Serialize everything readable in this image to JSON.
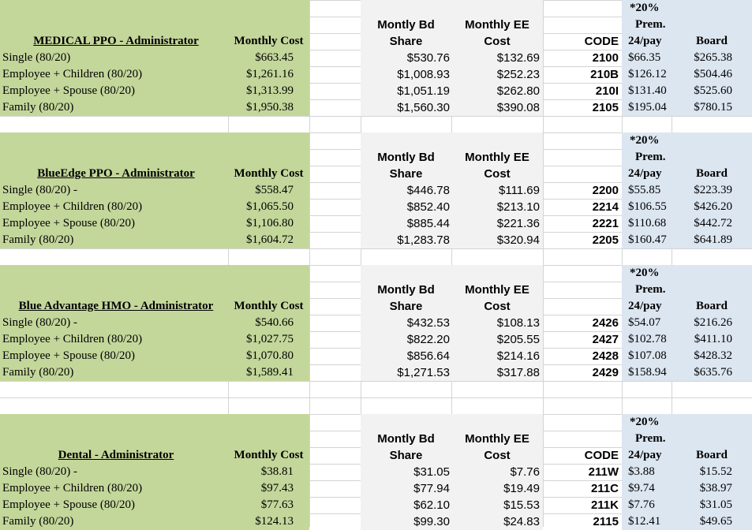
{
  "sections": [
    {
      "title": "MEDICAL PPO - Administrator",
      "cost_header": "Monthly Cost",
      "bd_header": [
        "Montly Bd",
        "Share"
      ],
      "ee_header": [
        "Monthly EE",
        "Cost"
      ],
      "code_header": "CODE",
      "prem_header": [
        "*20%",
        "Prem.",
        "24/pay"
      ],
      "board_header": "Board",
      "rows": [
        {
          "label": "Single (80/20)",
          "cost": "$663.45",
          "bd": "$530.76",
          "ee": "$132.69",
          "code": "2100",
          "prem": "$66.35",
          "board": "$265.38"
        },
        {
          "label": "Employee + Children (80/20)",
          "cost": "$1,261.16",
          "bd": "$1,008.93",
          "ee": "$252.23",
          "code": "210B",
          "prem": "$126.12",
          "board": "$504.46"
        },
        {
          "label": "Employee + Spouse (80/20)",
          "cost": "$1,313.99",
          "bd": "$1,051.19",
          "ee": "$262.80",
          "code": "210I",
          "prem": "$131.40",
          "board": "$525.60"
        },
        {
          "label": "Family (80/20)",
          "cost": "$1,950.38",
          "bd": "$1,560.30",
          "ee": "$390.08",
          "code": "2105",
          "prem": "$195.04",
          "board": "$780.15"
        }
      ]
    },
    {
      "title": "BlueEdge PPO - Administrator",
      "cost_header": "Monthly Cost",
      "bd_header": [
        "Montly Bd",
        "Share"
      ],
      "ee_header": [
        "Monthly EE",
        "Cost"
      ],
      "code_header": "",
      "prem_header": [
        "*20%",
        "Prem.",
        "24/pay"
      ],
      "board_header": "Board",
      "rows": [
        {
          "label": "Single (80/20) -",
          "cost": "$558.47",
          "bd": "$446.78",
          "ee": "$111.69",
          "code": "2200",
          "prem": "$55.85",
          "board": "$223.39"
        },
        {
          "label": "Employee + Children (80/20)",
          "cost": "$1,065.50",
          "bd": "$852.40",
          "ee": "$213.10",
          "code": "2214",
          "prem": "$106.55",
          "board": "$426.20"
        },
        {
          "label": "Employee + Spouse (80/20)",
          "cost": "$1,106.80",
          "bd": "$885.44",
          "ee": "$221.36",
          "code": "2221",
          "prem": "$110.68",
          "board": "$442.72"
        },
        {
          "label": "Family (80/20)",
          "cost": "$1,604.72",
          "bd": "$1,283.78",
          "ee": "$320.94",
          "code": "2205",
          "prem": "$160.47",
          "board": "$641.89"
        }
      ]
    },
    {
      "title": "Blue Advantage HMO - Administrator",
      "cost_header": "Monthly Cost",
      "bd_header": [
        "Montly Bd",
        "Share"
      ],
      "ee_header": [
        "Monthly EE",
        "Cost"
      ],
      "code_header": "",
      "prem_header": [
        "*20%",
        "Prem.",
        "24/pay"
      ],
      "board_header": "Board",
      "rows": [
        {
          "label": "Single (80/20) -",
          "cost": "$540.66",
          "bd": "$432.53",
          "ee": "$108.13",
          "code": "2426",
          "prem": "$54.07",
          "board": "$216.26"
        },
        {
          "label": "Employee + Children (80/20)",
          "cost": "$1,027.75",
          "bd": "$822.20",
          "ee": "$205.55",
          "code": "2427",
          "prem": "$102.78",
          "board": "$411.10"
        },
        {
          "label": "Employee + Spouse (80/20)",
          "cost": "$1,070.80",
          "bd": "$856.64",
          "ee": "$214.16",
          "code": "2428",
          "prem": "$107.08",
          "board": "$428.32"
        },
        {
          "label": "Family (80/20)",
          "cost": "$1,589.41",
          "bd": "$1,271.53",
          "ee": "$317.88",
          "code": "2429",
          "prem": "$158.94",
          "board": "$635.76"
        }
      ]
    },
    {
      "title": "Dental - Administrator",
      "cost_header": "Monthly Cost",
      "bd_header": [
        "Montly Bd",
        "Share"
      ],
      "ee_header": [
        "Monthly EE",
        "Cost"
      ],
      "code_header": "CODE",
      "prem_header": [
        "*20%",
        "Prem.",
        "24/pay"
      ],
      "board_header": "Board",
      "rows": [
        {
          "label": "Single (80/20) -",
          "cost": "$38.81",
          "bd": "$31.05",
          "ee": "$7.76",
          "code": "211W",
          "prem": "$3.88",
          "board": "$15.52"
        },
        {
          "label": "Employee + Children (80/20)",
          "cost": "$97.43",
          "bd": "$77.94",
          "ee": "$19.49",
          "code": "211C",
          "prem": "$9.74",
          "board": "$38.97"
        },
        {
          "label": "Employee + Spouse (80/20)",
          "cost": "$77.63",
          "bd": "$62.10",
          "ee": "$15.53",
          "code": "211K",
          "prem": "$7.76",
          "board": "$31.05"
        },
        {
          "label": "Family (80/20)",
          "cost": "$124.13",
          "bd": "$99.30",
          "ee": "$24.83",
          "code": "2115",
          "prem": "$12.41",
          "board": "$49.65"
        }
      ]
    }
  ],
  "colors": {
    "green": "#c4d79b",
    "gray": "#f2f2f2",
    "blue": "#dce6f1",
    "gridline": "#d4d4d4"
  }
}
